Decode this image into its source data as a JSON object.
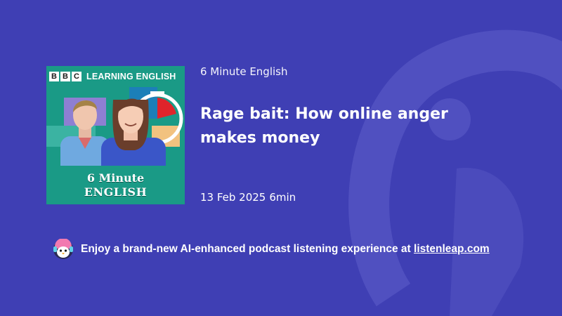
{
  "cover": {
    "brand_letters": [
      "B",
      "B",
      "C"
    ],
    "brand_title": "LEARNING ENGLISH",
    "line1": "6 Minute",
    "line2": "ENGLISH"
  },
  "episode": {
    "show_name": "6 Minute English",
    "title": "Rage bait: How online anger makes money",
    "date": "13 Feb 2025",
    "duration": "6min"
  },
  "promo": {
    "text": "Enjoy a brand-new AI-enhanced podcast listening experience at ",
    "link": "listenleap.com",
    "mascot_icon": "penguin-mascot-icon"
  },
  "colors": {
    "background": "#3f3fb4",
    "cover_teal": "#1a9a86",
    "accent_red": "#e0242b"
  }
}
